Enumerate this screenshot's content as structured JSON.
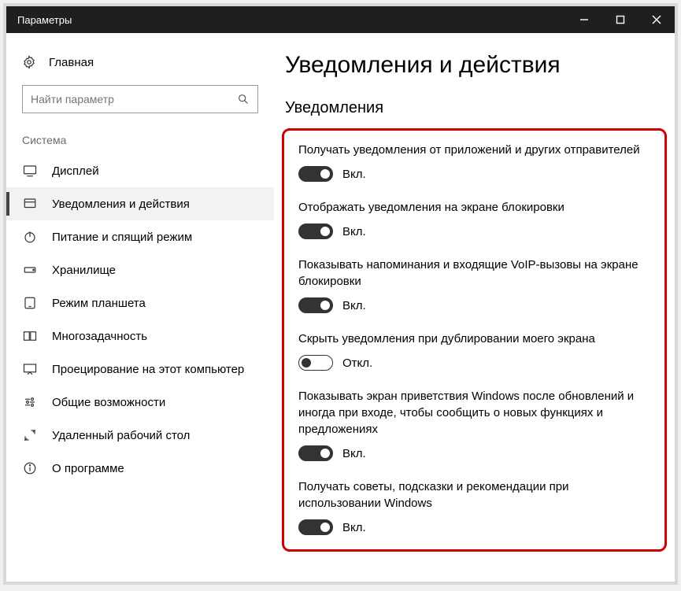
{
  "window": {
    "title": "Параметры"
  },
  "sidebar": {
    "home": "Главная",
    "search_placeholder": "Найти параметр",
    "section": "Система",
    "items": [
      {
        "label": "Дисплей"
      },
      {
        "label": "Уведомления и действия"
      },
      {
        "label": "Питание и спящий режим"
      },
      {
        "label": "Хранилище"
      },
      {
        "label": "Режим планшета"
      },
      {
        "label": "Многозадачность"
      },
      {
        "label": "Проецирование на этот компьютер"
      },
      {
        "label": "Общие возможности"
      },
      {
        "label": "Удаленный рабочий стол"
      },
      {
        "label": "О программе"
      }
    ]
  },
  "main": {
    "title": "Уведомления и действия",
    "section": "Уведомления",
    "on_label": "Вкл.",
    "off_label": "Откл.",
    "settings": [
      {
        "label": "Получать уведомления от приложений и других отправителей",
        "on": true
      },
      {
        "label": "Отображать уведомления на экране блокировки",
        "on": true
      },
      {
        "label": "Показывать напоминания и входящие VoIP-вызовы на экране блокировки",
        "on": true
      },
      {
        "label": "Скрыть уведомления при дублировании моего экрана",
        "on": false
      },
      {
        "label": "Показывать экран приветствия Windows после обновлений и иногда при входе, чтобы сообщить о новых функциях и предложениях",
        "on": true
      },
      {
        "label": "Получать советы, подсказки и рекомендации при использовании Windows",
        "on": true
      }
    ]
  }
}
